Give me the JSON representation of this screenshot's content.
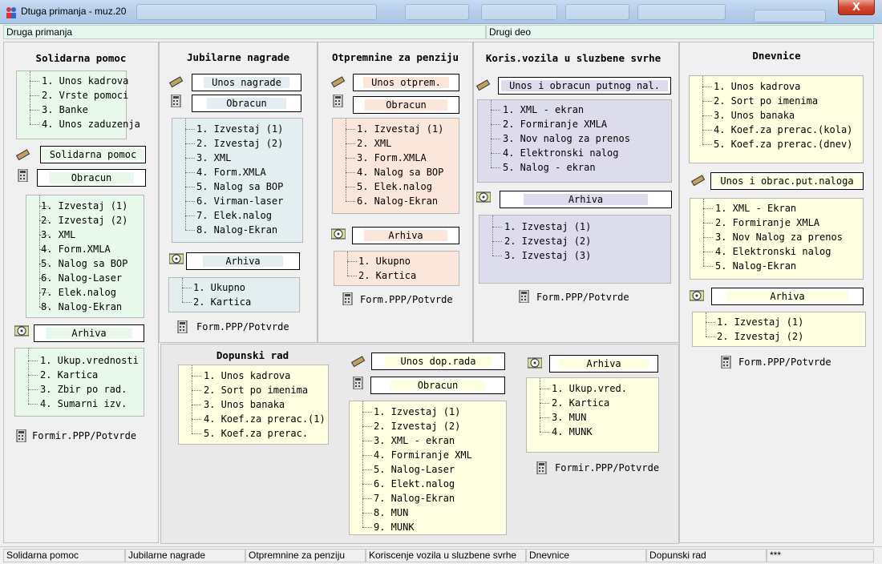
{
  "window": {
    "title": "Dtuga primanja - muz.20",
    "close_label": "X"
  },
  "topbar": {
    "left": "Druga primanja",
    "right": "Drugi deo"
  },
  "solidarna": {
    "heading": "Solidarna pomoc",
    "list1": [
      "1. Unos kadrova",
      "2. Vrste pomoci",
      "3. Banke",
      "4. Unos zaduzenja"
    ],
    "btn_unos": "Solidarna pomoc",
    "btn_obracun": "Obracun",
    "list2": [
      "1. Izvestaj (1)",
      "2. Izvestaj (2)",
      "3. XML",
      "4. Form.XMLA",
      "5. Nalog sa BOP",
      "6. Nalog-Laser",
      "7. Elek.nalog",
      "8. Nalog-Ekran"
    ],
    "btn_arhiva": "Arhiva",
    "list3": [
      "1. Ukup.vrednosti",
      "2. Kartica",
      "3. Zbir po rad.",
      "4. Sumarni izv."
    ],
    "footer": "Formir.PPP/Potvrde"
  },
  "jubilarne": {
    "heading": "Jubilarne nagrade",
    "btn_unos": "Unos nagrade",
    "btn_obracun": "Obracun",
    "list1": [
      "1. Izvestaj (1)",
      "2. Izvestaj (2)",
      "3. XML",
      "4. Form.XMLA",
      "5. Nalog sa BOP",
      "6. Virman-laser",
      "7. Elek.nalog",
      "8. Nalog-Ekran"
    ],
    "btn_arhiva": "Arhiva",
    "list2": [
      "1. Ukupno",
      "2. Kartica"
    ],
    "footer": "Form.PPP/Potvrde"
  },
  "otpremnine": {
    "heading": "Otpremnine za penziju",
    "btn_unos": "Unos otprem.",
    "btn_obracun": "Obracun",
    "list1": [
      "1. Izvestaj (1)",
      "2. XML",
      "3. Form.XMLA",
      "4. Nalog sa BOP",
      "5. Elek.nalog",
      "6. Nalog-Ekran"
    ],
    "btn_arhiva": "Arhiva",
    "list2": [
      "1. Ukupno",
      "2. Kartica"
    ],
    "footer": "Form.PPP/Potvrde"
  },
  "vozila": {
    "heading": "Koris.vozila u sluzbene svrhe",
    "btn_unos": "Unos i obracun putnog nal.",
    "list1": [
      "1. XML - ekran",
      "2. Formiranje XMLA",
      "3. Nov nalog za prenos",
      "4. Elektronski nalog",
      "5. Nalog - ekran"
    ],
    "btn_arhiva": "Arhiva",
    "list2": [
      "1. Izvestaj (1)",
      "2. Izvestaj (2)",
      "3. Izvestaj (3)"
    ],
    "footer": "Form.PPP/Potvrde"
  },
  "dnevnice": {
    "heading": "Dnevnice",
    "list1": [
      "1. Unos kadrova",
      "2. Sort po imenima",
      "3. Unos banaka",
      "4. Koef.za prerac.(kola)",
      "5. Koef.za prerac.(dnev)"
    ],
    "btn_unos": "Unos i obrac.put.naloga",
    "list2": [
      "1. XML - Ekran",
      "2. Formiranje XMLA",
      "3. Nov Nalog za prenos",
      "4. Elektronski nalog",
      "5. Nalog-Ekran"
    ],
    "btn_arhiva": "Arhiva",
    "list3": [
      "1. Izvestaj (1)",
      "2. Izvestaj (2)"
    ],
    "footer": "Form.PPP/Potvrde"
  },
  "dopunski": {
    "heading": "Dopunski rad",
    "list1": [
      "1. Unos kadrova",
      "2. Sort po imenima",
      "3. Unos banaka",
      "4. Koef.za prerac.(1)",
      "5. Koef.za prerac."
    ],
    "btn_unos": "Unos dop.rada",
    "btn_obracun": "Obracun",
    "list2": [
      "1. Izvestaj (1)",
      "2. Izvestaj (2)",
      "3. XML - ekran",
      "4. Formiranje XML",
      "5. Nalog-Laser",
      "6. Elekt.nalog",
      "7. Nalog-Ekran",
      "8. MUN",
      "9. MUNK"
    ],
    "btn_arhiva": "Arhiva",
    "list3": [
      "1. Ukup.vred.",
      "2. Kartica",
      "3. MUN",
      "4. MUNK"
    ],
    "footer": "Formir.PPP/Potvrde"
  },
  "statusbar": [
    "Solidarna pomoc",
    "Jubilarne nagrade",
    "Otpremnine za penziju",
    "Koriscenje vozila u sluzbene svrhe",
    "Dnevnice",
    "Dopunski rad",
    "***"
  ],
  "icons": {
    "edit": "pencil-icon",
    "calc": "calculator-icon",
    "archive": "disc-icon",
    "print": "calculator-icon"
  },
  "colors": {
    "green": "#e8f8ea",
    "teal": "#e2eef0",
    "salmon": "#fbe6dc",
    "lavender": "#dcdcec",
    "yellow": "#fefee0",
    "topbar": "#e6f7ef"
  }
}
